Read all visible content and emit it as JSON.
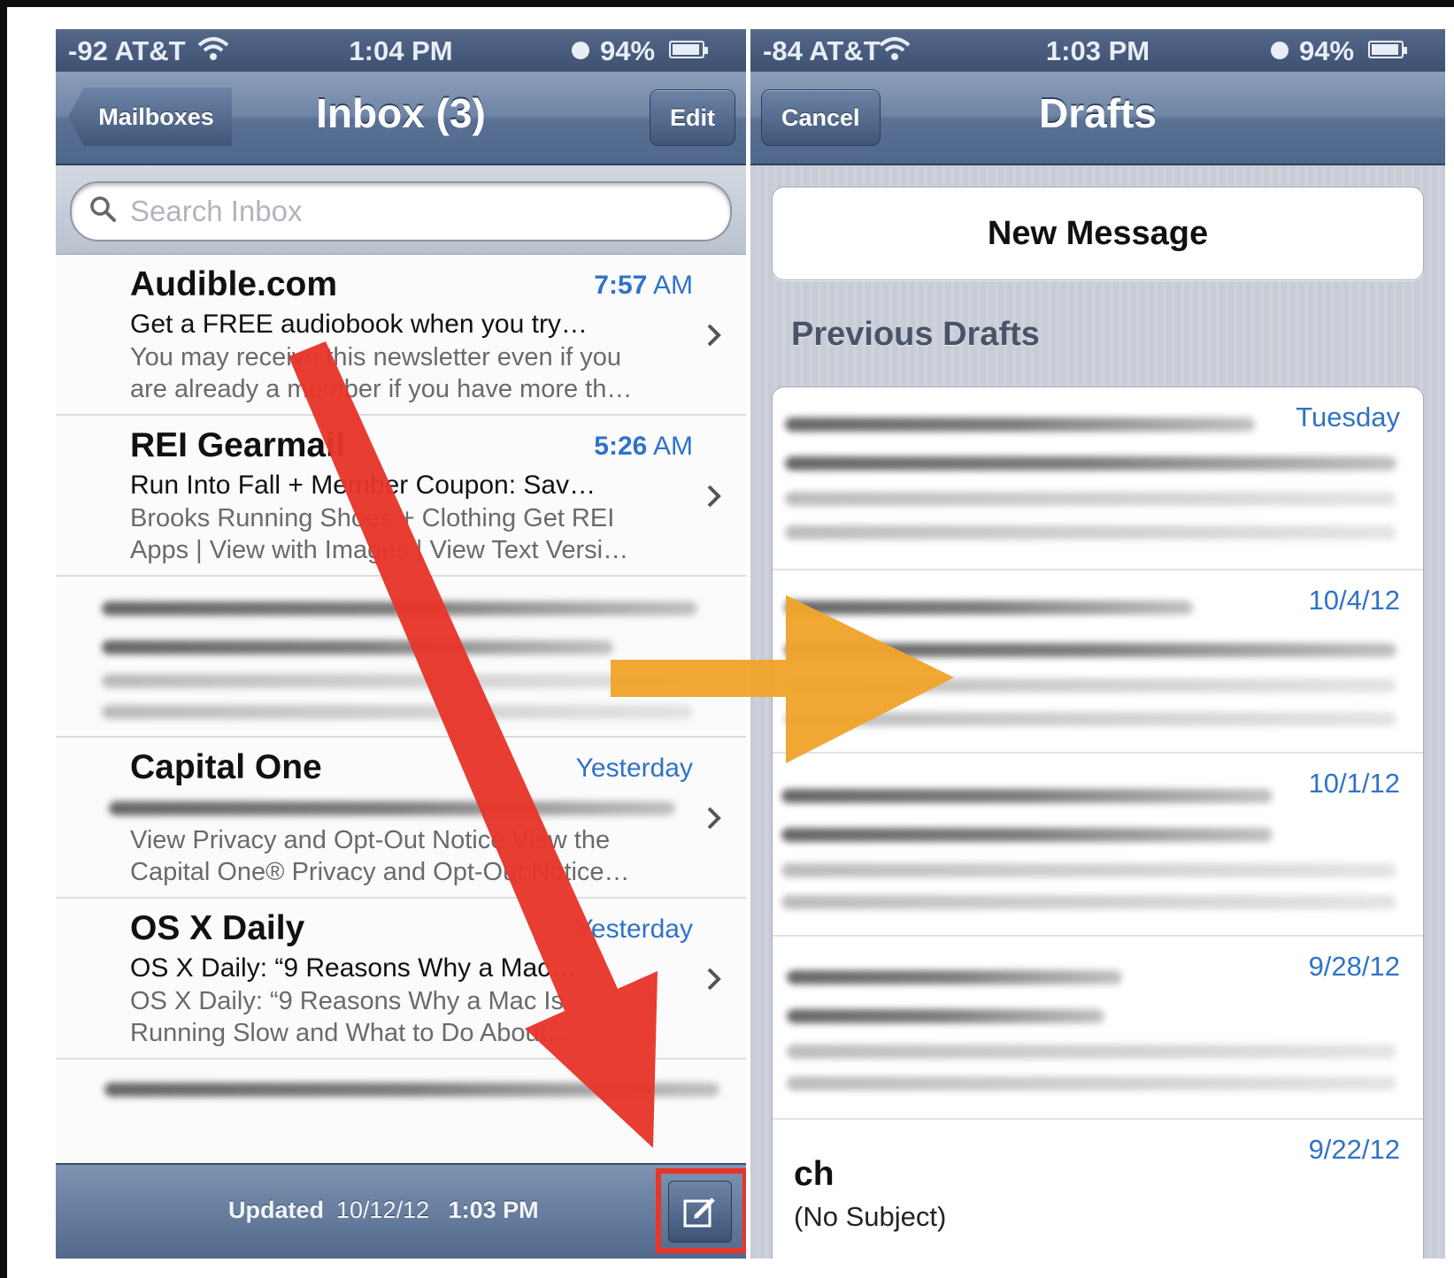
{
  "left_phone": {
    "status": {
      "carrier": "-92 AT&T",
      "time": "1:04 PM",
      "battery": "94%",
      "battery_level": 0.94
    },
    "nav": {
      "back_label": "Mailboxes",
      "title": "Inbox (3)",
      "edit_label": "Edit"
    },
    "search": {
      "placeholder": "Search Inbox"
    },
    "messages": [
      {
        "sender": "Audible.com",
        "time": "7:57",
        "ampm": "AM",
        "subject": "Get a FREE audiobook when you try…",
        "preview1": "You may receive this newsletter even if you",
        "preview2": "are already a member if you have more th…"
      },
      {
        "sender": "REI Gearmail",
        "time": "5:26",
        "ampm": "AM",
        "subject": "Run Into Fall + Member Coupon: Sav…",
        "preview1": "Brooks Running Shoes + Clothing Get REI",
        "preview2": "Apps | View with Images | View Text Versi…"
      },
      {
        "sender": "Capital One",
        "time": "Yesterday",
        "preview1": "View Privacy and Opt-Out Notice View the",
        "preview2": "Capital One® Privacy and Opt-Out Notice…"
      },
      {
        "sender": "OS X Daily",
        "time": "Yesterday",
        "subject": "OS X Daily: “9 Reasons Why a Mac…",
        "preview1": "OS X Daily: “9 Reasons Why a Mac Is",
        "preview2": "Running Slow and What to Do About…"
      }
    ],
    "toolbar": {
      "updated_label": "Updated",
      "updated_date": "10/12/12",
      "updated_time": "1:03 PM"
    }
  },
  "right_phone": {
    "status": {
      "carrier": "-84 AT&T",
      "time": "1:03 PM",
      "battery": "94%",
      "battery_level": 0.94
    },
    "nav": {
      "cancel_label": "Cancel",
      "title": "Drafts"
    },
    "new_message_label": "New Message",
    "previous_drafts_label": "Previous Drafts",
    "drafts": [
      {
        "date": "Tuesday"
      },
      {
        "date": "10/4/12"
      },
      {
        "date": "10/1/12"
      },
      {
        "date": "9/28/12"
      },
      {
        "date": "9/22/12",
        "name": "ch",
        "subject": "(No Subject)"
      }
    ]
  },
  "annotations": {
    "red_arrow_color": "#e7352a",
    "orange_arrow_color": "#f0a42c",
    "highlight_color": "#e7352a"
  },
  "icons": [
    "wifi-icon",
    "alarm-icon",
    "battery-icon",
    "search-icon",
    "chevron-right-icon",
    "compose-icon"
  ]
}
